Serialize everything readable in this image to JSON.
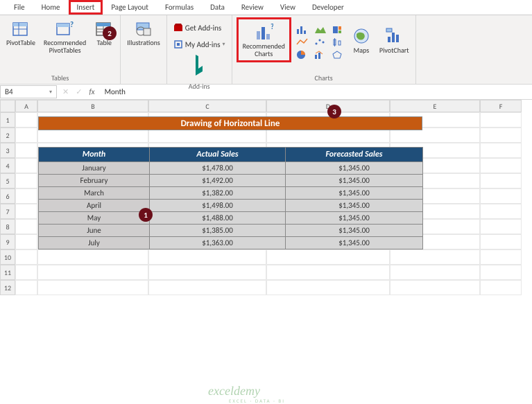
{
  "tabs": {
    "file": "File",
    "home": "Home",
    "insert": "Insert",
    "page_layout": "Page Layout",
    "formulas": "Formulas",
    "data": "Data",
    "review": "Review",
    "view": "View",
    "developer": "Developer"
  },
  "ribbon": {
    "tables": {
      "pivot": "PivotTable",
      "rec_pivot": "Recommended\nPivotTables",
      "table": "Table",
      "group": "Tables"
    },
    "illus": "Illustrations",
    "addins": {
      "get": "Get Add-ins",
      "my": "My Add-ins",
      "group": "Add-ins"
    },
    "charts": {
      "rec": "Recommended\nCharts",
      "maps": "Maps",
      "pivot_chart": "PivotChart",
      "group": "Charts"
    }
  },
  "namebox": "B4",
  "formula": "Month",
  "cols": [
    "A",
    "B",
    "C",
    "D",
    "E",
    "F"
  ],
  "rows": [
    "1",
    "2",
    "3",
    "4",
    "5",
    "6",
    "7",
    "8",
    "9",
    "10",
    "11",
    "12"
  ],
  "title": "Drawing of Horizontal Line",
  "table": {
    "headers": [
      "Month",
      "Actual Sales",
      "Forecasted Sales"
    ],
    "data": [
      [
        "January",
        "$1,478.00",
        "$1,345.00"
      ],
      [
        "February",
        "$1,492.00",
        "$1,345.00"
      ],
      [
        "March",
        "$1,382.00",
        "$1,345.00"
      ],
      [
        "April",
        "$1,498.00",
        "$1,345.00"
      ],
      [
        "May",
        "$1,488.00",
        "$1,345.00"
      ],
      [
        "June",
        "$1,385.00",
        "$1,345.00"
      ],
      [
        "July",
        "$1,363.00",
        "$1,345.00"
      ]
    ]
  },
  "badges": [
    "1",
    "2",
    "3"
  ],
  "watermark": "exceldemy",
  "watermark_sub": "EXCEL · DATA · BI",
  "chart_data": {
    "type": "table",
    "title": "Drawing of Horizontal Line",
    "columns": [
      "Month",
      "Actual Sales",
      "Forecasted Sales"
    ],
    "rows": [
      {
        "Month": "January",
        "Actual Sales": 1478.0,
        "Forecasted Sales": 1345.0
      },
      {
        "Month": "February",
        "Actual Sales": 1492.0,
        "Forecasted Sales": 1345.0
      },
      {
        "Month": "March",
        "Actual Sales": 1382.0,
        "Forecasted Sales": 1345.0
      },
      {
        "Month": "April",
        "Actual Sales": 1498.0,
        "Forecasted Sales": 1345.0
      },
      {
        "Month": "May",
        "Actual Sales": 1488.0,
        "Forecasted Sales": 1345.0
      },
      {
        "Month": "June",
        "Actual Sales": 1385.0,
        "Forecasted Sales": 1345.0
      },
      {
        "Month": "July",
        "Actual Sales": 1363.0,
        "Forecasted Sales": 1345.0
      }
    ]
  }
}
